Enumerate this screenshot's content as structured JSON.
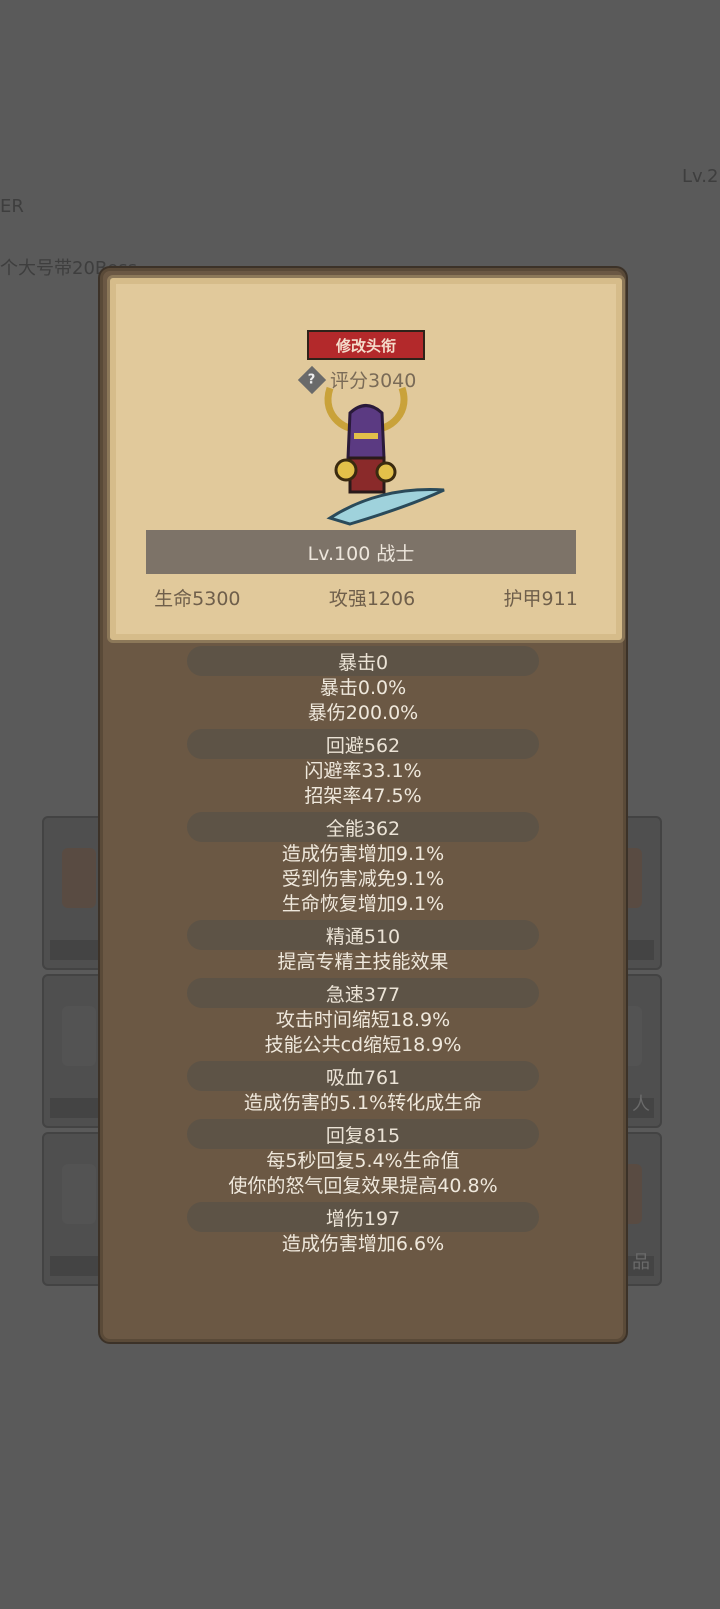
{
  "background": {
    "level_label": "Lv.2",
    "name_fragment": "ER",
    "task_fragment": "个大号带20Boss",
    "slot_labels": [
      "人",
      "品"
    ]
  },
  "card": {
    "title_button": "修改头衔",
    "score": "评分3040",
    "level_class": "Lv.100 战士",
    "stats": {
      "hp": "生命5300",
      "atk": "攻强1206",
      "armor": "护甲911"
    }
  },
  "groups": [
    {
      "header": "暴击0",
      "lines": [
        "暴击0.0%",
        "暴伤200.0%"
      ]
    },
    {
      "header": "回避562",
      "lines": [
        "闪避率33.1%",
        "招架率47.5%"
      ]
    },
    {
      "header": "全能362",
      "lines": [
        "造成伤害增加9.1%",
        "受到伤害减免9.1%",
        "生命恢复增加9.1%"
      ]
    },
    {
      "header": "精通510",
      "lines": [
        "提高专精主技能效果"
      ]
    },
    {
      "header": "急速377",
      "lines": [
        "攻击时间缩短18.9%",
        "技能公共cd缩短18.9%"
      ]
    },
    {
      "header": "吸血761",
      "lines": [
        "造成伤害的5.1%转化成生命"
      ]
    },
    {
      "header": "回复815",
      "lines": [
        "每5秒回复5.4%生命值",
        "使你的怒气回复效果提高40.8%"
      ]
    },
    {
      "header": "增伤197",
      "lines": [
        "造成伤害增加6.6%"
      ]
    }
  ],
  "colors": {
    "title_button": "#b3292b",
    "card": "#e1c99b",
    "panel": "#6b5844"
  }
}
